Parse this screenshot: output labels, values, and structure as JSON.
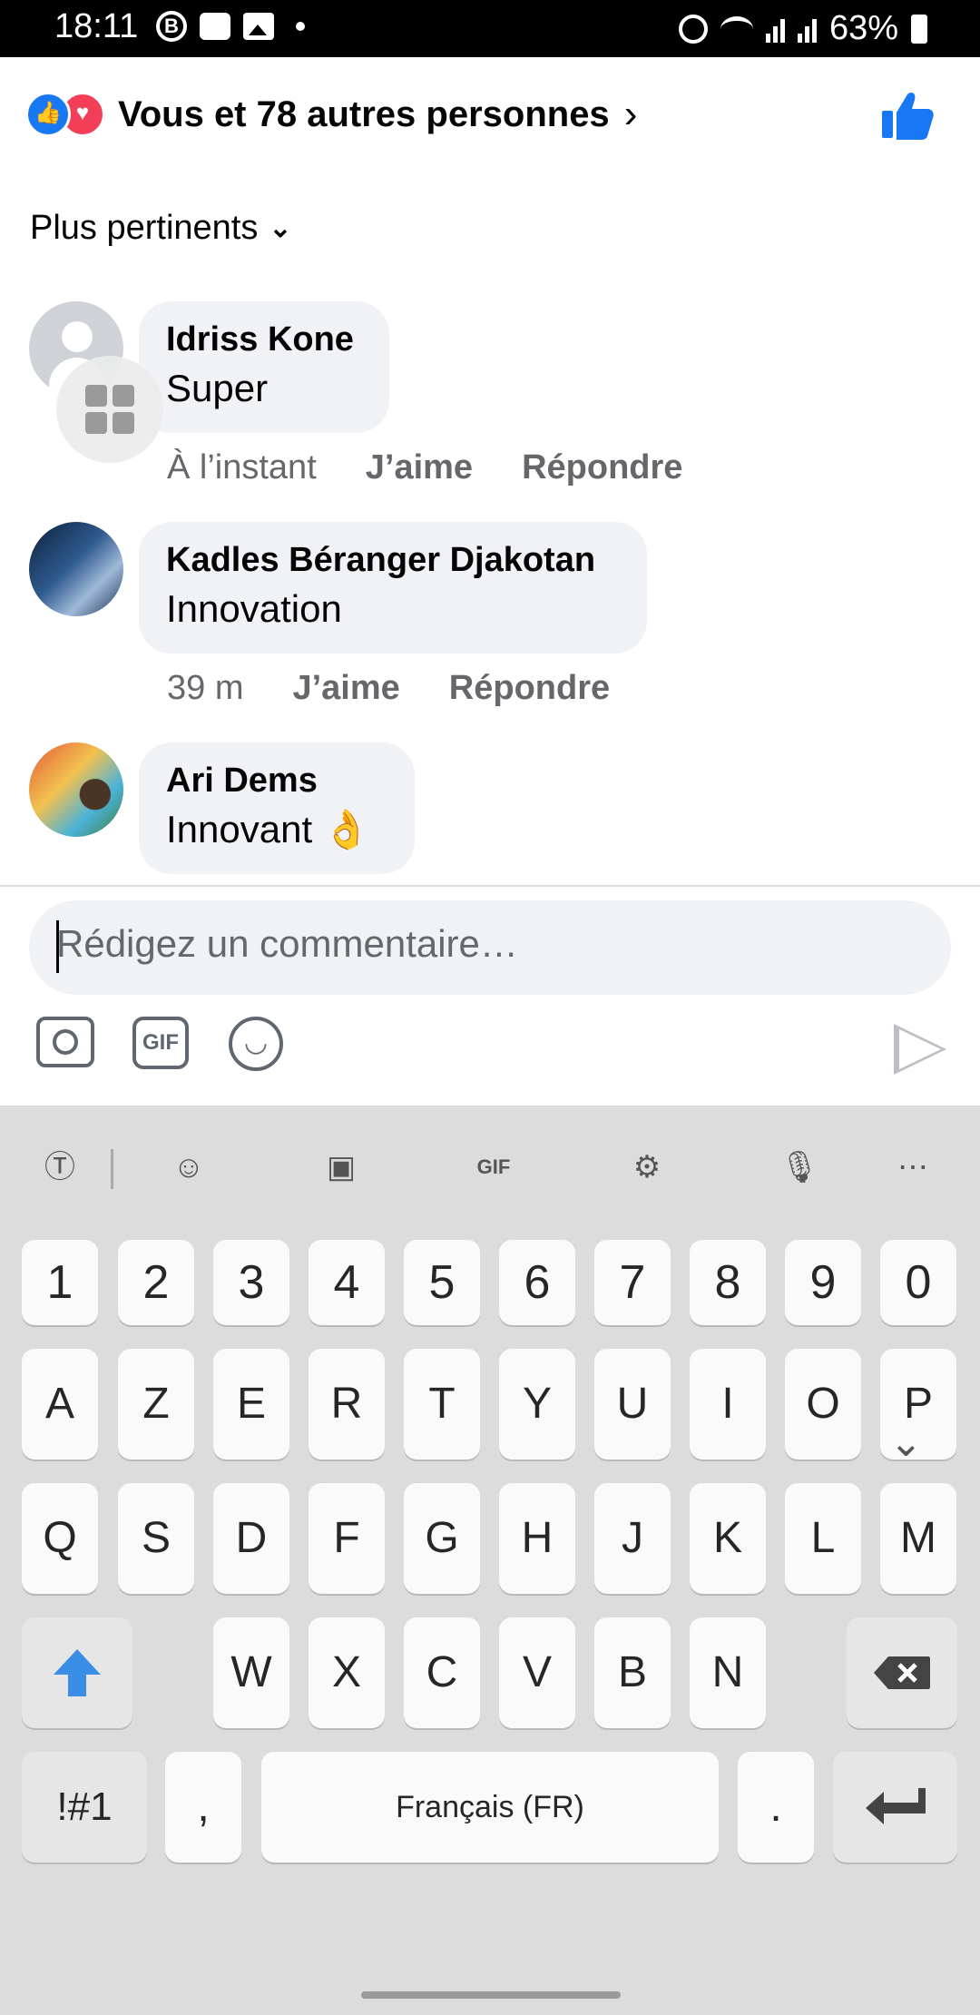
{
  "status_bar": {
    "time": "18:11",
    "battery": "63%",
    "b_badge": "B"
  },
  "reactions": {
    "summary": "Vous et 78 autres personnes",
    "like_color": "#1877f2",
    "love_color": "#f33e58"
  },
  "sort": {
    "label": "Plus pertinents"
  },
  "comments": [
    {
      "author": "Idriss Kone",
      "text": "Super",
      "time": "À l’instant",
      "like": "J’aime",
      "reply": "Répondre"
    },
    {
      "author": "Kadles Béranger Djakotan",
      "text": "Innovation",
      "time": "39 m",
      "like": "J’aime",
      "reply": "Répondre"
    },
    {
      "author": "Ari Dems",
      "text": "Innovant 👌"
    }
  ],
  "composer": {
    "placeholder": "Rédigez un commentaire…",
    "gif_label": "GIF"
  },
  "keyboard": {
    "gif_label": "GIF",
    "row_numbers": [
      "1",
      "2",
      "3",
      "4",
      "5",
      "6",
      "7",
      "8",
      "9",
      "0"
    ],
    "row1": [
      "A",
      "Z",
      "E",
      "R",
      "T",
      "Y",
      "U",
      "I",
      "O",
      "P"
    ],
    "row2": [
      "Q",
      "S",
      "D",
      "F",
      "G",
      "H",
      "J",
      "K",
      "L",
      "M"
    ],
    "row3": [
      "W",
      "X",
      "C",
      "V",
      "B",
      "N"
    ],
    "symbols_key": "!#1",
    "comma_key": ",",
    "space_label": "Français (FR)",
    "period_key": "."
  }
}
